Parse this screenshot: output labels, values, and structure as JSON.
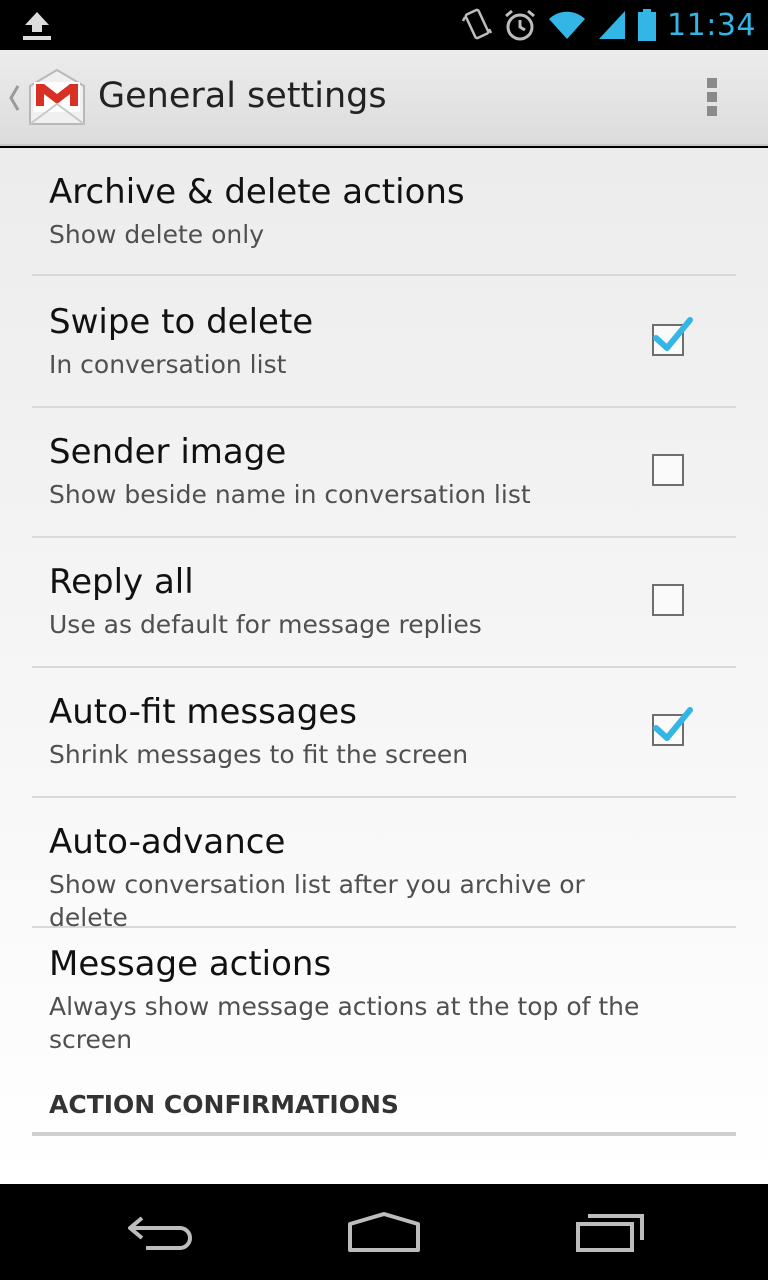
{
  "status_bar": {
    "time": "11:34",
    "icons": [
      "upload-icon",
      "vibrate-icon",
      "alarm-icon",
      "wifi-icon",
      "signal-icon",
      "battery-icon"
    ],
    "accent_color": "#33b5e5"
  },
  "action_bar": {
    "title": "General settings",
    "icons": [
      "back-caret-icon",
      "gmail-logo-icon",
      "overflow-menu-icon"
    ]
  },
  "preferences": [
    {
      "title": "Archive & delete actions",
      "summary": "Show delete only",
      "has_checkbox": false,
      "checked": false
    },
    {
      "title": "Swipe to delete",
      "summary": "In conversation list",
      "has_checkbox": true,
      "checked": true
    },
    {
      "title": "Sender image",
      "summary": "Show beside name in conversation list",
      "has_checkbox": true,
      "checked": false
    },
    {
      "title": "Reply all",
      "summary": "Use as default for message replies",
      "has_checkbox": true,
      "checked": false
    },
    {
      "title": "Auto-fit messages",
      "summary": "Shrink messages to fit the screen",
      "has_checkbox": true,
      "checked": true
    },
    {
      "title": "Auto-advance",
      "summary": "Show conversation list after you archive or delete",
      "has_checkbox": false,
      "checked": false
    },
    {
      "title": "Message actions",
      "summary": "Always show message actions at the top of the screen",
      "has_checkbox": false,
      "checked": false
    }
  ],
  "section_header": "ACTION CONFIRMATIONS",
  "nav_bar": {
    "icons": [
      "back-icon",
      "home-icon",
      "recent-apps-icon"
    ]
  },
  "colors": {
    "check_blue": "#33b5e5",
    "gmail_red": "#d93025"
  }
}
